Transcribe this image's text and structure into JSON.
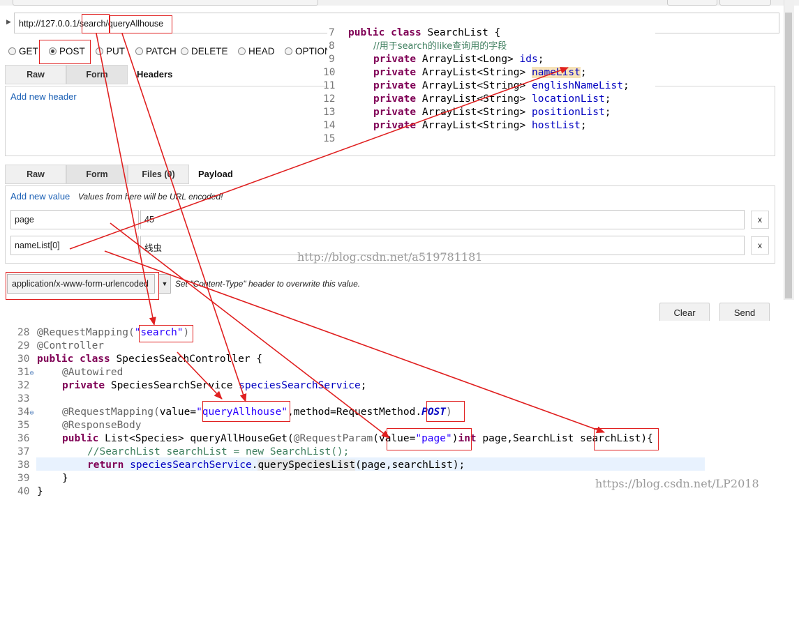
{
  "url": {
    "value": "http://127.0.0.1/search/queryAllhouse"
  },
  "methods": [
    {
      "label": "GET",
      "selected": false
    },
    {
      "label": "POST",
      "selected": true
    },
    {
      "label": "PUT",
      "selected": false
    },
    {
      "label": "PATCH",
      "selected": false
    },
    {
      "label": "DELETE",
      "selected": false
    },
    {
      "label": "HEAD",
      "selected": false
    },
    {
      "label": "OPTION",
      "selected": false
    }
  ],
  "headers_section": {
    "tabs": [
      "Raw",
      "Form"
    ],
    "label": "Headers",
    "add_link": "Add new header"
  },
  "payload_section": {
    "tabs": [
      "Raw",
      "Form",
      "Files (0)"
    ],
    "label": "Payload",
    "add_link": "Add new value",
    "hint": "Values from here will be URL encoded!",
    "rows": [
      {
        "key": "page",
        "value": "45",
        "remove": "x"
      },
      {
        "key": "nameList[0]",
        "value": "线虫",
        "remove": "x"
      }
    ]
  },
  "content_type": {
    "value": "application/x-www-form-urlencoded",
    "hint": "Set \"Content-Type\" header to overwrite this value."
  },
  "actions": {
    "clear": "Clear",
    "send": "Send"
  },
  "watermarks": {
    "mid": "http://blog.csdn.net/a519781181",
    "bottom": "https://blog.csdn.net/LP2018"
  },
  "searchlist_code": {
    "lines": [
      {
        "n": "7",
        "text": "public class SearchList {"
      },
      {
        "n": "8",
        "text": "//用于search的like查询用的字段"
      },
      {
        "n": "9",
        "text": "private ArrayList<Long> ids;"
      },
      {
        "n": "10",
        "text": "private ArrayList<String> nameList;"
      },
      {
        "n": "11",
        "text": "private ArrayList<String> englishNameList;"
      },
      {
        "n": "12",
        "text": "private ArrayList<String> locationList;"
      },
      {
        "n": "13",
        "text": "private ArrayList<String> positionList;"
      },
      {
        "n": "14",
        "text": "private ArrayList<String> hostList;"
      },
      {
        "n": "15",
        "text": ""
      }
    ]
  },
  "controller_code": {
    "lines": [
      {
        "n": "28",
        "text": "@RequestMapping(\"search\")"
      },
      {
        "n": "29",
        "text": "@Controller"
      },
      {
        "n": "30",
        "text": "public class SpeciesSeachController {"
      },
      {
        "n": "31",
        "text": "@Autowired"
      },
      {
        "n": "32",
        "text": "private SpeciesSearchService speciesSearchService;"
      },
      {
        "n": "33",
        "text": ""
      },
      {
        "n": "34",
        "text": "@RequestMapping(value=\"queryAllhouse\",method=RequestMethod.POST)"
      },
      {
        "n": "35",
        "text": "@ResponseBody"
      },
      {
        "n": "36",
        "text": "public List<Species> queryAllHouseGet(@RequestParam(value=\"page\")int page,SearchList searchList){"
      },
      {
        "n": "37",
        "text": "//SearchList searchList = new SearchList();"
      },
      {
        "n": "38",
        "text": "return speciesSearchService.querySpeciesList(page,searchList);"
      },
      {
        "n": "39",
        "text": "}"
      },
      {
        "n": "40",
        "text": "}"
      }
    ]
  },
  "colors": {
    "annotation_red": "#e02020",
    "link_blue": "#1a5fb4",
    "keyword": "#7f0055"
  }
}
